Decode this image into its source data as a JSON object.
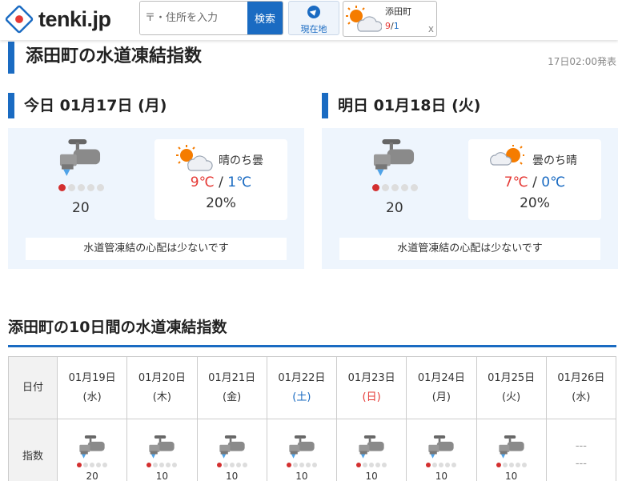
{
  "header": {
    "logo_text": "tenki.jp",
    "search_placeholder": "〒・住所を入力",
    "search_button": "検索",
    "location_button": "現在地",
    "history": {
      "name": "添田町",
      "high": "9",
      "slash": "/",
      "low": "1",
      "close": "x"
    }
  },
  "page": {
    "title": "添田町の水道凍結指数",
    "announce": "17日02:00発表"
  },
  "days": [
    {
      "title": "今日 01月17日 (月)",
      "index": "20",
      "level": 1,
      "weather": "晴のち曇",
      "weather_icon": "sun-cloud-icon",
      "high": "9℃",
      "low": "1℃",
      "slash": " / ",
      "pop": "20%",
      "message": "水道管凍結の心配は少ないです"
    },
    {
      "title": "明日 01月18日 (火)",
      "index": "20",
      "level": 1,
      "weather": "曇のち晴",
      "weather_icon": "cloud-sun-icon",
      "high": "7℃",
      "low": "0℃",
      "slash": " / ",
      "pop": "20%",
      "message": "水道管凍結の心配は少ないです"
    }
  ],
  "ten_day": {
    "title": "添田町の10日間の水道凍結指数",
    "row_date_label": "日付",
    "row_index_label": "指数",
    "columns": [
      {
        "date": "01月19日",
        "dow": "(水)",
        "dow_class": "",
        "index": "10",
        "level": 1
      },
      {
        "date": "01月20日",
        "dow": "(木)",
        "dow_class": "",
        "index": "10",
        "level": 1
      },
      {
        "date": "01月21日",
        "dow": "(金)",
        "dow_class": "",
        "index": "10",
        "level": 1
      },
      {
        "date": "01月22日",
        "dow": "(土)",
        "dow_class": "sat",
        "index": "10",
        "level": 1
      },
      {
        "date": "01月23日",
        "dow": "(日)",
        "dow_class": "sun",
        "index": "10",
        "level": 1
      },
      {
        "date": "01月24日",
        "dow": "(月)",
        "dow_class": "",
        "index": "10",
        "level": 1
      },
      {
        "date": "01月25日",
        "dow": "(火)",
        "dow_class": "",
        "index": "10",
        "level": 1
      },
      {
        "date": "01月26日",
        "dow": "(水)",
        "dow_class": "",
        "index": "---",
        "level": 0
      }
    ],
    "first_index": "20",
    "dash": "---"
  },
  "colors": {
    "accent": "#1a6bc2",
    "high": "#e53935",
    "low": "#1a6bc2",
    "card_bg": "#eef5fd"
  }
}
